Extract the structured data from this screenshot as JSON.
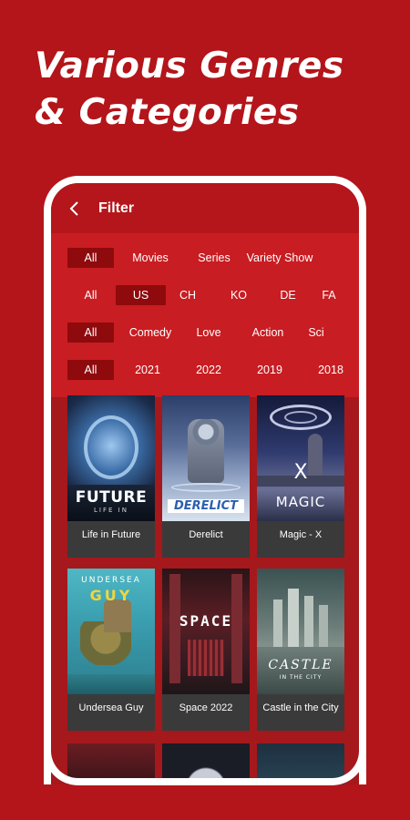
{
  "headline": {
    "line1": "Various Genres",
    "line2": "& Categories"
  },
  "screen": {
    "title": "Filter",
    "back_icon": "chevron-left-icon"
  },
  "filters": {
    "types": [
      {
        "label": "All",
        "selected": true
      },
      {
        "label": "Movies",
        "selected": false
      },
      {
        "label": "Series",
        "selected": false
      },
      {
        "label": "Variety Show",
        "selected": false
      }
    ],
    "regions": [
      {
        "label": "All",
        "selected": false
      },
      {
        "label": "US",
        "selected": true
      },
      {
        "label": "CH",
        "selected": false
      },
      {
        "label": "KO",
        "selected": false
      },
      {
        "label": "DE",
        "selected": false
      },
      {
        "label": "FA",
        "selected": false
      }
    ],
    "genres": [
      {
        "label": "All",
        "selected": true
      },
      {
        "label": "Comedy",
        "selected": false
      },
      {
        "label": "Love",
        "selected": false
      },
      {
        "label": "Action",
        "selected": false
      },
      {
        "label": "Sci",
        "selected": false
      }
    ],
    "years": [
      {
        "label": "All",
        "selected": true
      },
      {
        "label": "2021",
        "selected": false
      },
      {
        "label": "2022",
        "selected": false
      },
      {
        "label": "2019",
        "selected": false
      },
      {
        "label": "2018",
        "selected": false
      }
    ]
  },
  "movies": [
    {
      "title": "Life in Future",
      "poster_text": "FUTURE",
      "poster_sub": "LIFE IN"
    },
    {
      "title": "Derelict",
      "poster_text": "DERELICT",
      "poster_sub": ""
    },
    {
      "title": "Magic - X",
      "poster_text": "MAGIC",
      "poster_sub": "X"
    },
    {
      "title": "Undersea Guy",
      "poster_text": "GUY",
      "poster_sub": "UNDERSEA"
    },
    {
      "title": "Space 2022",
      "poster_text": "SPACE",
      "poster_sub": ""
    },
    {
      "title": "Castle in the City",
      "poster_text": "CASTLE",
      "poster_sub": "IN THE CITY"
    }
  ],
  "colors": {
    "background": "#b3151a",
    "chip_selected": "#8e0a0d",
    "card": "#3a3a3a"
  }
}
